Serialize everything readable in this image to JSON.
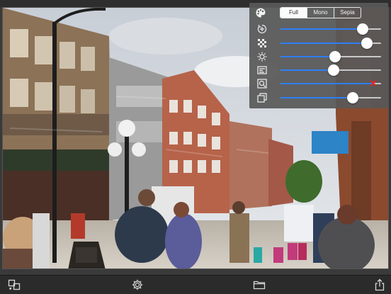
{
  "filter_modes": {
    "options": [
      "Full",
      "Mono",
      "Sepia"
    ],
    "selected": "Full"
  },
  "sliders": [
    {
      "icon": "hue-rotate-icon",
      "value": 0.82
    },
    {
      "icon": "checkerboard-icon",
      "value": 0.86
    },
    {
      "icon": "brightness-icon",
      "value": 0.54
    },
    {
      "icon": "contrast-icon",
      "value": 0.53
    },
    {
      "icon": "zoom-detail-icon",
      "value": 0.92,
      "disabled_marker": true
    },
    {
      "icon": "layers-icon",
      "value": 0.72
    }
  ],
  "colors": {
    "accent": "#2d7ff9",
    "panel": "#585858",
    "toolbar": "#2b2b2b",
    "marker": "#ee2222"
  },
  "toolbar": {
    "icons": [
      "compare-icon",
      "settings-gear-icon",
      "folder-icon",
      "share-icon"
    ]
  }
}
